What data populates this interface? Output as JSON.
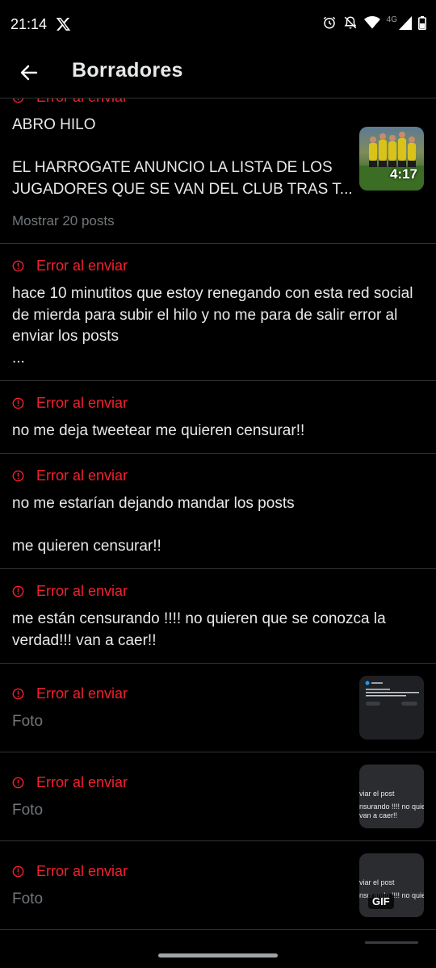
{
  "status": {
    "time": "21:14",
    "network": "4G"
  },
  "header": {
    "title": "Borradores"
  },
  "drafts": [
    {
      "error": "Error al enviar",
      "text": "ABRO HILO\n\nEL HARROGATE ANUNCIO LA LISTA DE LOS JUGADORES QUE SE VAN DEL CLUB TRAS T...",
      "more": "Mostrar 20 posts",
      "thumb": {
        "kind": "video",
        "duration": "4:17"
      }
    },
    {
      "error": "Error al enviar",
      "text": "hace 10 minutitos que estoy renegando con esta red social de mierda para subir el hilo y no me para de salir error al enviar los posts\n..."
    },
    {
      "error": "Error al enviar",
      "text": "no me deja tweetear me quieren censurar!!"
    },
    {
      "error": "Error al enviar",
      "text": "no me estarían dejando mandar los posts\n\nme quieren censurar!!"
    },
    {
      "error": "Error al enviar",
      "text": "me están censurando !!!! no quieren que se conozca la verdad!!! van a caer!!"
    },
    {
      "error": "Error al enviar",
      "text": "Foto",
      "thumb": {
        "kind": "screenshot-ui"
      }
    },
    {
      "error": "Error al enviar",
      "text": "Foto",
      "thumb": {
        "kind": "screenshot-text",
        "lines": [
          "viar el post",
          "nsurando !!!! no quiere",
          "van a caer!!"
        ]
      }
    },
    {
      "error": "Error al enviar",
      "text": "Foto",
      "thumb": {
        "kind": "screenshot-text",
        "lines": [
          "viar el post",
          "nsurando !!!! no quiere"
        ],
        "badge": "GIF"
      }
    }
  ],
  "icons": {
    "back": "arrow-left-icon",
    "error": "alert-circle-icon"
  },
  "colors": {
    "error": "#f4212e",
    "muted": "#71767b",
    "divider": "#2f3336"
  }
}
